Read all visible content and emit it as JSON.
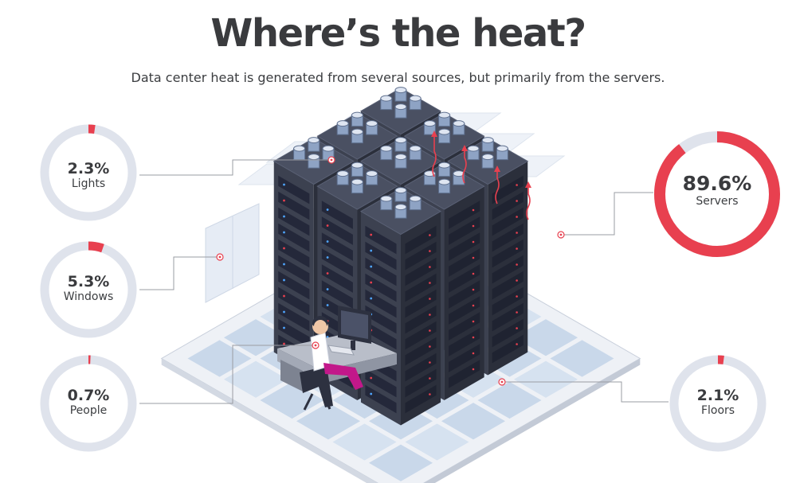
{
  "header": {
    "title": "Where’s the heat?",
    "subtitle": "Data center heat is generated from several sources, but primarily from the servers."
  },
  "colors": {
    "accent": "#e8404f",
    "track": "#dfe3ec",
    "floor_tile": "#c9d8ea",
    "rack": "#3c4150",
    "leader_line": "#9a9ca3"
  },
  "chart_data": {
    "type": "pie",
    "title": "Where’s the heat?",
    "subtitle": "Data center heat is generated from several sources, but primarily from the servers.",
    "slices": [
      {
        "label": "Lights",
        "value": 2.3,
        "display": "2.3%"
      },
      {
        "label": "Windows",
        "value": 5.3,
        "display": "5.3%"
      },
      {
        "label": "People",
        "value": 0.7,
        "display": "0.7%"
      },
      {
        "label": "Servers",
        "value": 89.6,
        "display": "89.6%"
      },
      {
        "label": "Floors",
        "value": 2.1,
        "display": "2.1%"
      }
    ]
  }
}
